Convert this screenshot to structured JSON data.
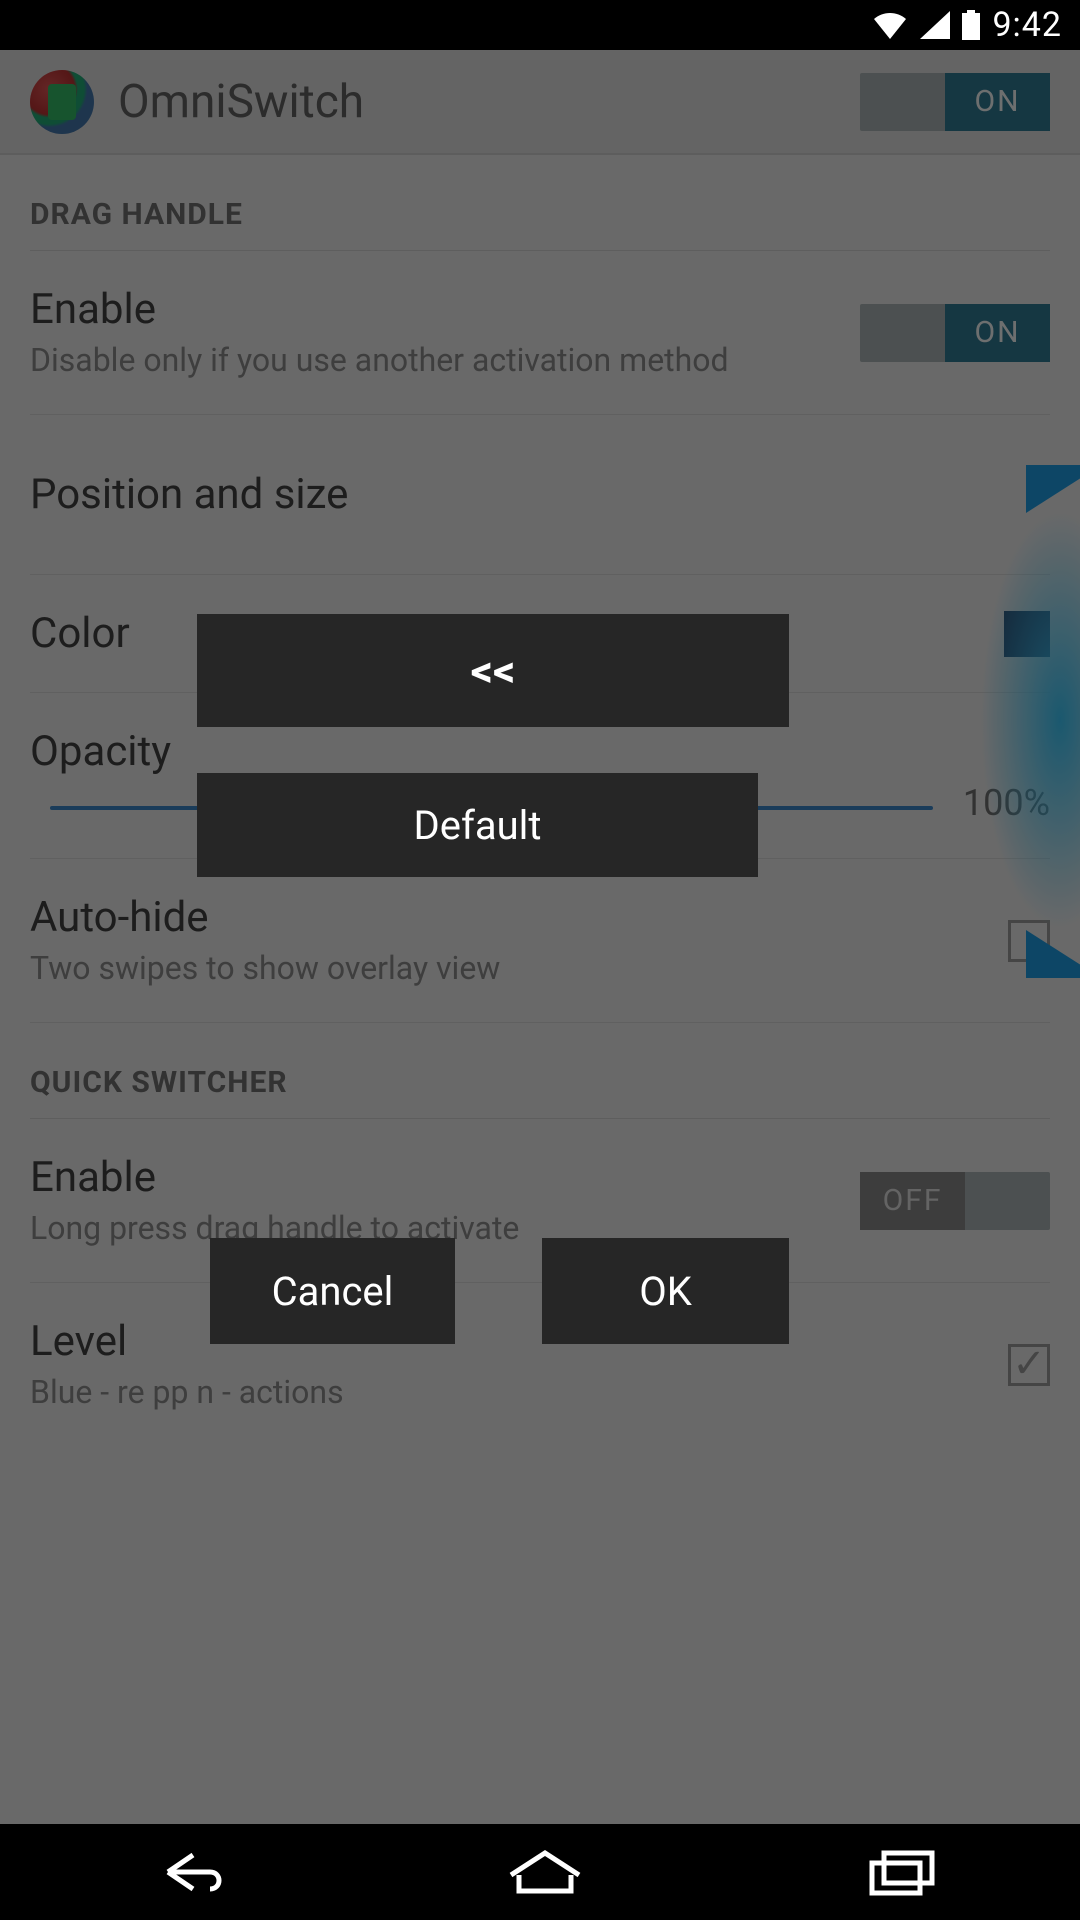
{
  "statusbar": {
    "time": "9:42"
  },
  "header": {
    "title": "OmniSwitch",
    "toggle_on_label": "ON"
  },
  "sections": {
    "drag_handle": {
      "header": "DRAG HANDLE",
      "enable": {
        "title": "Enable",
        "subtitle": "Disable only if you use another activation method",
        "toggle_label": "ON"
      },
      "position": {
        "title": "Position and size"
      },
      "color": {
        "title": "Color"
      },
      "opacity": {
        "title": "Opacity",
        "value": "100%"
      },
      "autohide": {
        "title": "Auto-hide",
        "subtitle": "Two swipes to show overlay view"
      }
    },
    "quick_switcher": {
      "header": "QUICK SWITCHER",
      "enable": {
        "title": "Enable",
        "subtitle": "Long press drag handle to activate",
        "toggle_label": "OFF"
      },
      "level": {
        "title": "Level",
        "subtitle": "Blue - re    pp      n -     actions"
      }
    }
  },
  "dialog": {
    "collapse_label": "<<",
    "default_label": "Default",
    "cancel_label": "Cancel",
    "ok_label": "OK"
  }
}
